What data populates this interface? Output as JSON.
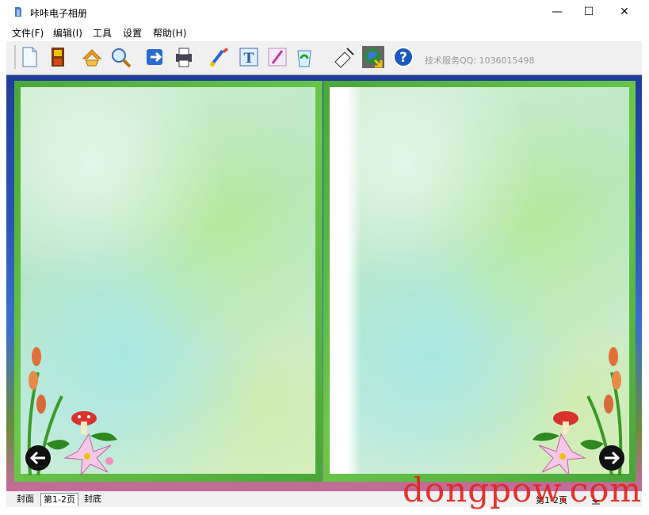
{
  "window": {
    "title": "咔咔电子相册",
    "minimize": "—",
    "maximize": "☐",
    "close": "✕"
  },
  "menu": [
    "文件(F)",
    "编辑(I)",
    "工具",
    "设置",
    "帮助(H)"
  ],
  "toolbar": {
    "icons": [
      "new-file-icon",
      "save-icon",
      "open-icon",
      "search-icon",
      "export-icon",
      "print-icon",
      "brush-icon",
      "text-icon",
      "pen-icon",
      "recycle-icon",
      "edit-tools-icon",
      "globe-icon",
      "help-icon"
    ],
    "tech_support": "技术服务QQ: 1036015498"
  },
  "tabs": [
    "封面",
    "第1-2页",
    "封底"
  ],
  "page_indicator": "第1-2页",
  "watermark": "dongpow.com",
  "colors": {
    "frame_green": "#4aa83a",
    "background_blue": "#2a56b6",
    "watermark_red": "#e0261e"
  }
}
